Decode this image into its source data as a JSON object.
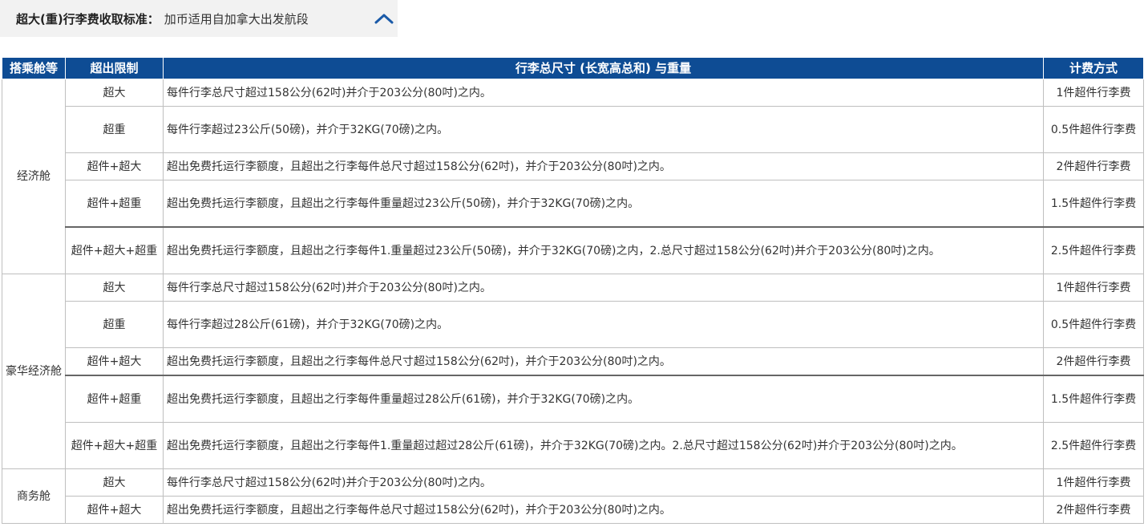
{
  "accordion": {
    "label": "超大(重)行李费收取标准",
    "separator": "：",
    "value": "加币适用自加拿大出发航段",
    "icon": "chevron-up-icon",
    "accent": "#1a5aa8"
  },
  "table": {
    "header_bg": "#0e4c94",
    "headers": [
      "搭乘舱等",
      "超出限制",
      "行李总尺寸 (长宽高总和) 与重量",
      "计费方式"
    ],
    "groups": [
      {
        "cabin": "经济舱",
        "rows": [
          {
            "limit": "超大",
            "desc": "每件行李总尺寸超过158公分(62吋)并介于203公分(80吋)之内。",
            "fee": "1件超件行李费"
          },
          {
            "limit": "超重",
            "desc": "每件行李超过23公斤(50磅)，并介于32KG(70磅)之内。",
            "fee": "0.5件超件行李费"
          },
          {
            "limit": "超件+超大",
            "desc": "超出免费托运行李额度，且超出之行李每件总尺寸超过158公分(62吋)，并介于203公分(80吋)之内。",
            "fee": "2件超件行李费"
          },
          {
            "limit": "超件+超重",
            "desc": "超出免费托运行李额度，且超出之行李每件重量超过23公斤(50磅)，并介于32KG(70磅)之内。",
            "fee": "1.5件超件行李费"
          },
          {
            "limit": "超件+超大+超重",
            "desc": "超出免费托运行李额度，且超出之行李每件1.重量超过23公斤(50磅)，并介于32KG(70磅)之内，2.总尺寸超过158公分(62吋)并介于203公分(80吋)之内。",
            "fee": "2.5件超件行李费"
          }
        ]
      },
      {
        "cabin": "豪华经济舱",
        "rows": [
          {
            "limit": "超大",
            "desc": "每件行李总尺寸超过158公分(62吋)并介于203公分(80吋)之内。",
            "fee": "1件超件行李费"
          },
          {
            "limit": "超重",
            "desc": "每件行李超过28公斤(61磅)，并介于32KG(70磅)之内。",
            "fee": "0.5件超件行李费"
          },
          {
            "limit": "超件+超大",
            "desc": "超出免费托运行李额度，且超出之行李每件总尺寸超过158公分(62吋)，并介于203公分(80吋)之内。",
            "fee": "2件超件行李费"
          },
          {
            "limit": "超件+超重",
            "desc": "超出免费托运行李额度，且超出之行李每件重量超过28公斤(61磅)，并介于32KG(70磅)之内。",
            "fee": "1.5件超件行李费"
          },
          {
            "limit": "超件+超大+超重",
            "desc": "超出免费托运行李额度，且超出之行李每件1.重量超过超过28公斤(61磅)，并介于32KG(70磅)之内。2.总尺寸超过158公分(62吋)并介于203公分(80吋)之内。",
            "fee": "2.5件超件行李费"
          }
        ]
      },
      {
        "cabin": "商务舱",
        "rows": [
          {
            "limit": "超大",
            "desc": "每件行李总尺寸超过158公分(62吋)并介于203公分(80吋)之内。",
            "fee": "1件超件行李费"
          },
          {
            "limit": "超件+超大",
            "desc": "超出免费托运行李额度，且超出之行李每件总尺寸超过158公分(62吋)，并介于203公分(80吋)之内。",
            "fee": "2件超件行李费"
          }
        ]
      }
    ]
  }
}
